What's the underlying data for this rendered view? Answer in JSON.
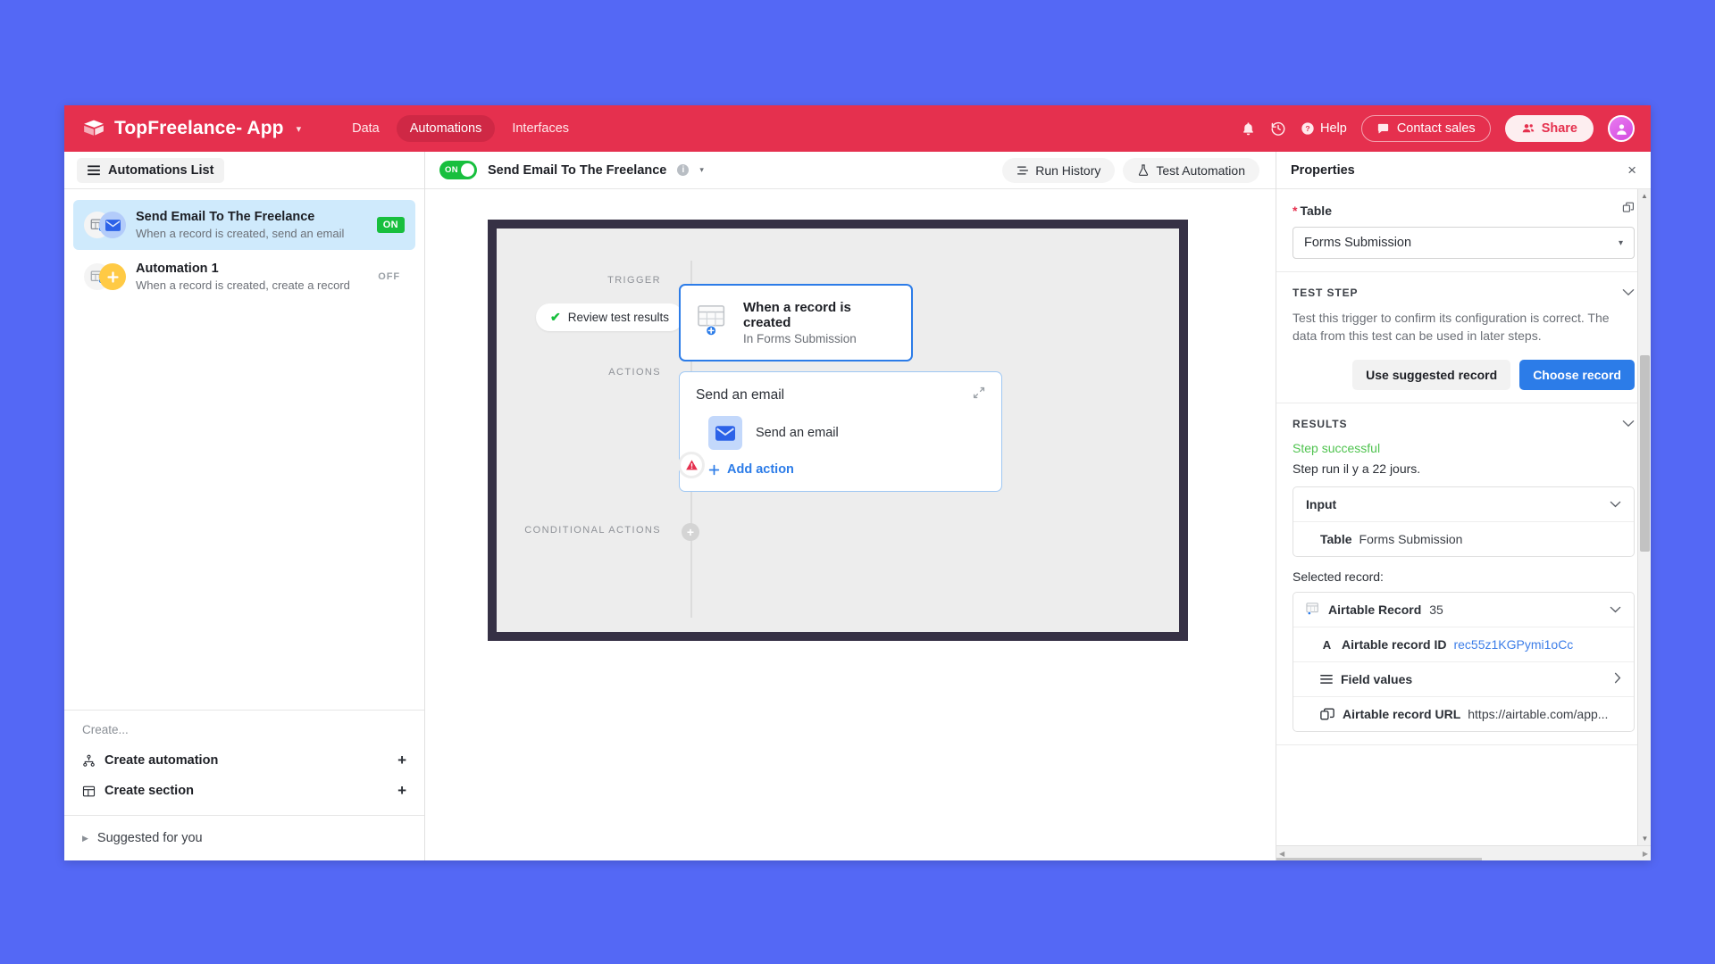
{
  "topbar": {
    "brand_name": "TopFreelance- App",
    "brand_caret": "▾",
    "nav": [
      {
        "label": "Data",
        "active": false
      },
      {
        "label": "Automations",
        "active": true
      },
      {
        "label": "Interfaces",
        "active": false
      }
    ],
    "help_label": "Help",
    "contact_sales_label": "Contact sales",
    "share_label": "Share",
    "accent_color": "#e5304e",
    "nav_active_color": "#cf2845"
  },
  "sidebar": {
    "list_button_label": "Automations List",
    "automations": [
      {
        "title": "Send Email To The Freelance",
        "subtitle": "When a record is created, send an email",
        "status": "ON",
        "selected": true
      },
      {
        "title": "Automation 1",
        "subtitle": "When a record is created, create a record",
        "status": "OFF",
        "selected": false
      }
    ],
    "create_heading": "Create...",
    "create_items": [
      {
        "label": "Create automation",
        "plus": "+"
      },
      {
        "label": "Create section",
        "plus": "+"
      }
    ],
    "suggested_label": "Suggested for you"
  },
  "canvas": {
    "toggle_label": "ON",
    "automation_name": "Send Email To The Freelance",
    "info_glyph": "i",
    "title_caret": "▾",
    "run_history_label": "Run History",
    "test_automation_label": "Test Automation",
    "lanes": {
      "trigger": "TRIGGER",
      "actions": "ACTIONS",
      "conditional_actions": "CONDITIONAL ACTIONS"
    },
    "review_test_results_label": "Review test results",
    "trigger_card": {
      "title": "When a record is created",
      "subtitle": "In Forms Submission"
    },
    "action_card": {
      "title": "Send an email",
      "row_label": "Send an email",
      "add_action_label": "Add action"
    },
    "frame_color": "#363145",
    "frame_bg": "#ededed"
  },
  "properties": {
    "title": "Properties",
    "close_glyph": "×",
    "table_field": {
      "label": "Table",
      "required_mark": "*",
      "value": "Forms Submission",
      "caret": "▾"
    },
    "test_step": {
      "title": "TEST STEP",
      "description": "Test this trigger to confirm its configuration is correct. The data from this test can be used in later steps.",
      "secondary_button": "Use suggested record",
      "primary_button": "Choose record",
      "primary_color": "#2c7ce8"
    },
    "results": {
      "title": "RESULTS",
      "status": "Step successful",
      "status_color": "#4fc34f",
      "run_time": "Step run il y a 22 jours.",
      "input": {
        "label": "Input",
        "rows": [
          {
            "key": "Table",
            "value": "Forms Submission"
          }
        ]
      },
      "selected_record_label": "Selected record:",
      "record": {
        "header_label": "Airtable Record",
        "header_count": "35",
        "rows": [
          {
            "icon": "text-field-icon",
            "key": "Airtable record ID",
            "value": "rec55z1KGPymi1oCc",
            "link": true
          },
          {
            "icon": "list-icon",
            "key": "Field values",
            "value": "",
            "caret": "›"
          },
          {
            "icon": "url-icon",
            "key": "Airtable record URL",
            "value": "https://airtable.com/app...",
            "link": false
          }
        ]
      }
    }
  }
}
